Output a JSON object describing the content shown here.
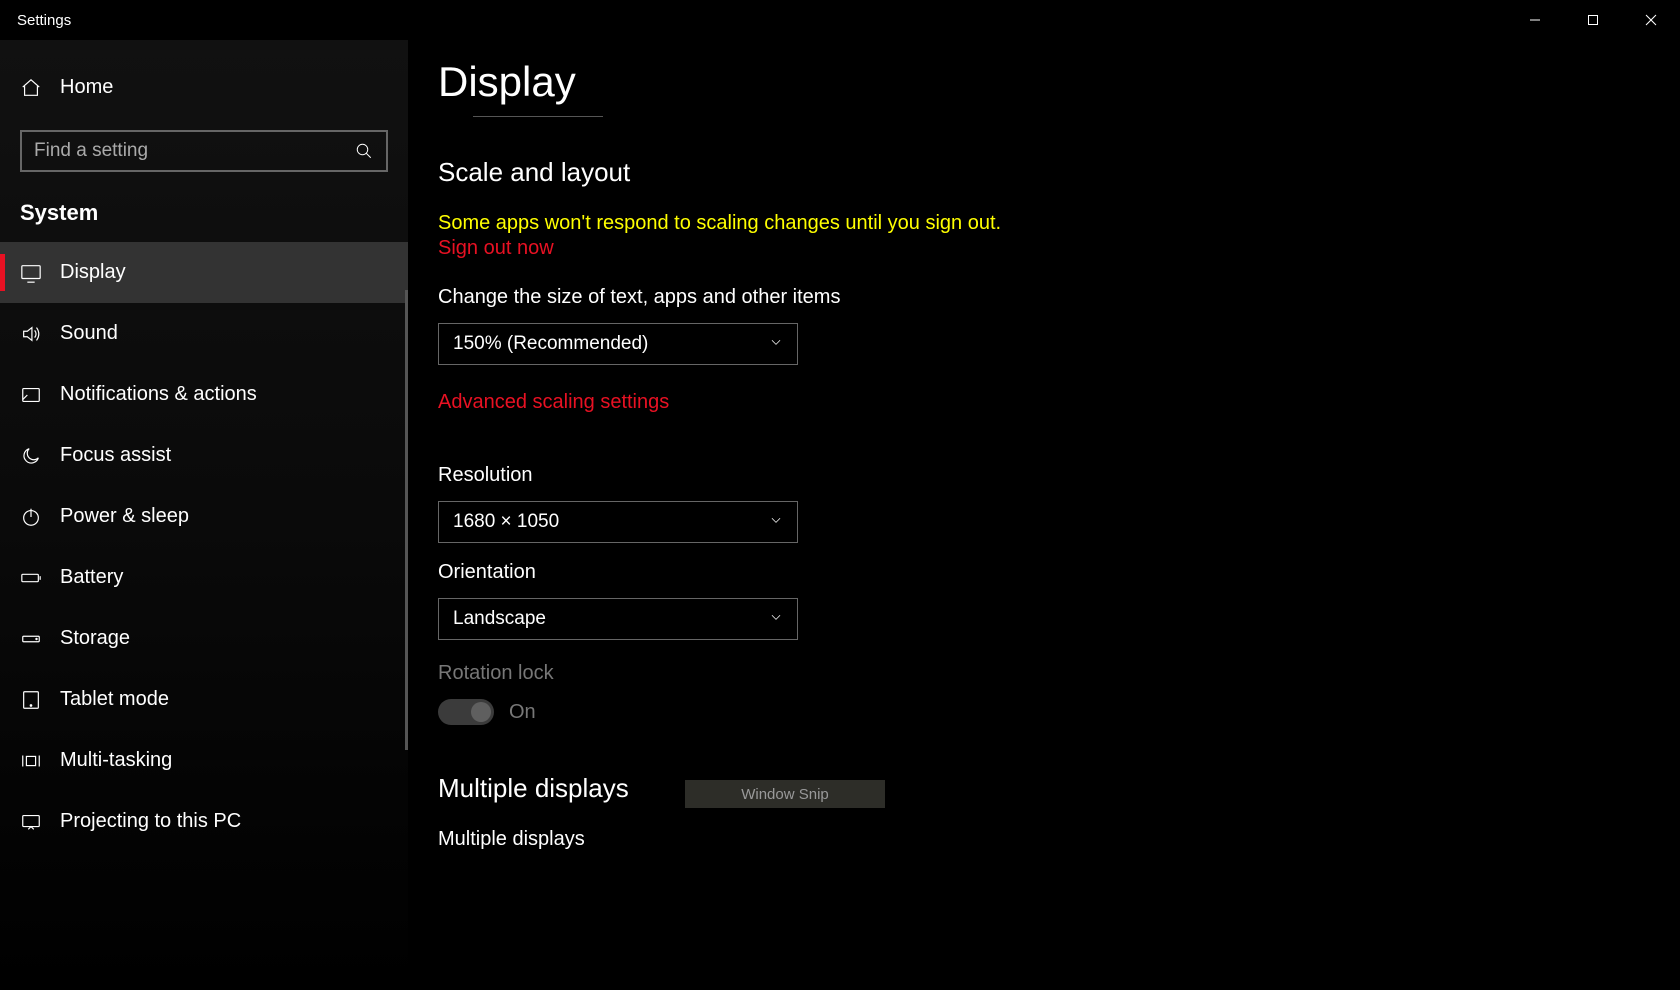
{
  "window": {
    "title": "Settings"
  },
  "sidebar": {
    "home_label": "Home",
    "search_placeholder": "Find a setting",
    "category": "System",
    "items": [
      {
        "id": "display",
        "label": "Display",
        "selected": true
      },
      {
        "id": "sound",
        "label": "Sound",
        "selected": false
      },
      {
        "id": "notifications",
        "label": "Notifications & actions",
        "selected": false
      },
      {
        "id": "focus-assist",
        "label": "Focus assist",
        "selected": false
      },
      {
        "id": "power-sleep",
        "label": "Power & sleep",
        "selected": false
      },
      {
        "id": "battery",
        "label": "Battery",
        "selected": false
      },
      {
        "id": "storage",
        "label": "Storage",
        "selected": false
      },
      {
        "id": "tablet-mode",
        "label": "Tablet mode",
        "selected": false
      },
      {
        "id": "multi-tasking",
        "label": "Multi-tasking",
        "selected": false
      },
      {
        "id": "projecting",
        "label": "Projecting to this PC",
        "selected": false
      }
    ]
  },
  "page": {
    "title": "Display",
    "scale_section": {
      "header": "Scale and layout",
      "warning": "Some apps won't respond to scaling changes until you sign out.",
      "sign_out_link": "Sign out now",
      "size_label": "Change the size of text, apps and other items",
      "size_value": "150% (Recommended)",
      "advanced_link": "Advanced scaling settings",
      "resolution_label": "Resolution",
      "resolution_value": "1680 × 1050",
      "orientation_label": "Orientation",
      "orientation_value": "Landscape",
      "rotation_lock_label": "Rotation lock",
      "rotation_lock_state": "On"
    },
    "multiple_section": {
      "header": "Multiple displays",
      "field_label": "Multiple displays"
    }
  },
  "overlay": {
    "snip_label": "Window Snip"
  }
}
